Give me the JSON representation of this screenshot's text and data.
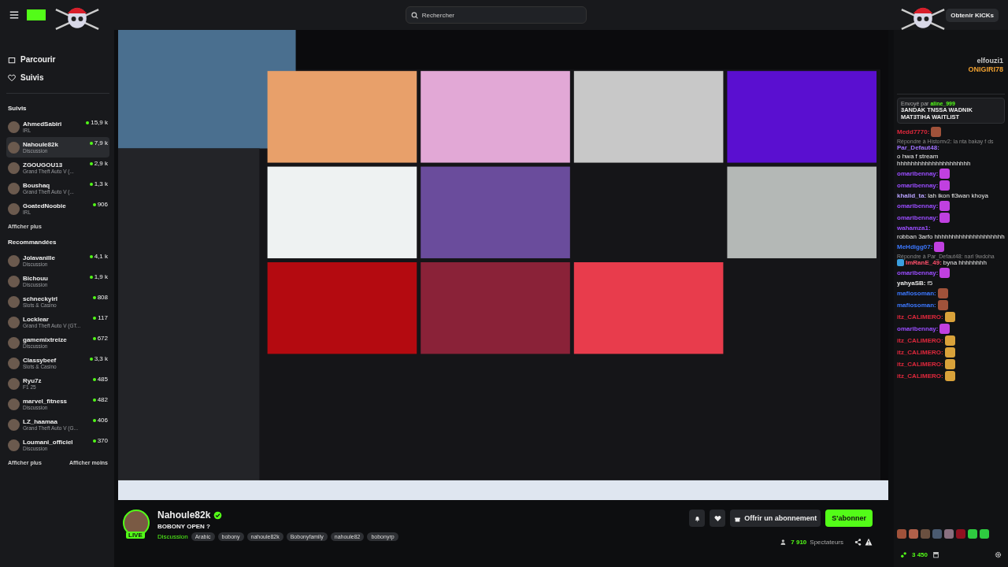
{
  "top_bar": {
    "search": {
      "placeholder": "Rechercher"
    },
    "kicks_button": "Obtenir KICKs"
  },
  "sidebar": {
    "nav": [
      {
        "label": "Parcourir"
      },
      {
        "label": "Suivis"
      }
    ],
    "followed_title": "Suivis",
    "followed": [
      {
        "name": "AhmedSabiri",
        "category": "IRL",
        "viewers": "15,9 k",
        "selected": false
      },
      {
        "name": "Nahoule82k",
        "category": "Discussion",
        "viewers": "7,9 k",
        "selected": true
      },
      {
        "name": "ZGOUGOU13",
        "category": "Grand Theft Auto V (...",
        "viewers": "2,9 k",
        "selected": false
      },
      {
        "name": "Boushaq",
        "category": "Grand Theft Auto V (...",
        "viewers": "1,3 k",
        "selected": false
      },
      {
        "name": "GoatedNoobie",
        "category": "IRL",
        "viewers": "906",
        "selected": false
      }
    ],
    "followed_more": "Afficher plus",
    "recommended_title": "Recommandées",
    "recommended": [
      {
        "name": "Jolavanille",
        "category": "Discussion",
        "viewers": "4,1 k",
        "selected": false
      },
      {
        "name": "Bichouu",
        "category": "Discussion",
        "viewers": "1,9 k",
        "selected": false
      },
      {
        "name": "schneckyirl",
        "category": "Slots & Casino",
        "viewers": "808",
        "selected": false
      },
      {
        "name": "Locklear",
        "category": "Grand Theft Auto V (GT...",
        "viewers": "117",
        "selected": false
      },
      {
        "name": "gamemixtreize",
        "category": "Discussion",
        "viewers": "672",
        "selected": false
      },
      {
        "name": "Classybeef",
        "category": "Slots & Casino",
        "viewers": "3,3 k",
        "selected": false
      },
      {
        "name": "Ryu7z",
        "category": "F1 25",
        "viewers": "485",
        "selected": false
      },
      {
        "name": "marvel_fitness",
        "category": "Discussion",
        "viewers": "482",
        "selected": false
      },
      {
        "name": "LZ_haamaa",
        "category": "Grand Theft Auto V (G...",
        "viewers": "406",
        "selected": false
      },
      {
        "name": "Loumani_officiel",
        "category": "Discussion",
        "viewers": "370",
        "selected": false
      }
    ],
    "more": "Afficher plus",
    "less": "Afficher moins"
  },
  "stream": {
    "streamer": "Nahoule82k",
    "live_badge": "LIVE",
    "title": "BOBONY OPEN ?",
    "category": "Discussion",
    "tags": [
      "Arabic",
      "bobony",
      "nahoule82k",
      "Bobonyfamily",
      "nahoule82",
      "bobonyrp"
    ],
    "gift_button": "Offrir un abonnement",
    "subscribe_button": "S'abonner",
    "viewers": "7 910",
    "viewers_label": "Spectateurs"
  },
  "chat": {
    "leaderboard": [
      {
        "name": "elfouzi1",
        "color": "#c8c8c8"
      },
      {
        "name": "ONIGIRI78",
        "color": "#f0a030"
      }
    ],
    "pinned": {
      "sent_by": "Envoyé par",
      "user": "aline_999",
      "text": "3ANDAK TNSSA WADNIK MAT3TIHA WAITLIST"
    },
    "messages": [
      {
        "user": "Medd7770:",
        "color": "#e0283c",
        "kind": "face"
      },
      {
        "reply": "Répondre à Histomv2: la nta bakay f ds",
        "user": "Par_Defaut48:",
        "color": "#a070ff",
        "kind": "text",
        "text": "o hwa f stream hhhhhhhhhhhhhhhhhhhhh"
      },
      {
        "user": "omaribennay:",
        "color": "#9b4dff",
        "kind": "pepe"
      },
      {
        "user": "omaribennay:",
        "color": "#9b4dff",
        "kind": "pepe"
      },
      {
        "user": "khalid_ta:",
        "color": "#b9a3ff",
        "kind": "text",
        "text": "lah ikon fl3wan khoya"
      },
      {
        "user": "omaribennay:",
        "color": "#9b4dff",
        "kind": "pepe"
      },
      {
        "user": "omaribennay:",
        "color": "#9b4dff",
        "kind": "pepe"
      },
      {
        "user": "wahamza1:",
        "color": "#9b4dff",
        "kind": "text",
        "text": "robban 3arfo hhhhhhhhhhhhhhhhhhhh"
      },
      {
        "user": "MeHdigg07:",
        "color": "#3c78ff",
        "kind": "pepe"
      },
      {
        "reply": "Répondre à Par_Defaut48: narl 9wdoha",
        "user": "ImRanE_49:",
        "color": "#ff4f6a",
        "kind": "text",
        "text": "byna hhhhhhhh",
        "badge": true
      },
      {
        "user": "omaribennay:",
        "color": "#9b4dff",
        "kind": "pepe"
      },
      {
        "user": "yahyaSB:",
        "color": "#e8e8e8",
        "kind": "text",
        "text": "f5"
      },
      {
        "user": "mafiosoman:",
        "color": "#3c78ff",
        "kind": "face"
      },
      {
        "user": "mafiosoman:",
        "color": "#3c78ff",
        "kind": "face"
      },
      {
        "user": "itz_CALIMERO:",
        "color": "#e0283c",
        "kind": "gg"
      },
      {
        "user": "omaribennay:",
        "color": "#9b4dff",
        "kind": "pepe"
      },
      {
        "user": "itz_CALIMERO:",
        "color": "#e0283c",
        "kind": "gg"
      },
      {
        "user": "itz_CALIMERO:",
        "color": "#e0283c",
        "kind": "gg"
      },
      {
        "user": "itz_CALIMERO:",
        "color": "#e0283c",
        "kind": "gg"
      },
      {
        "user": "itz_CALIMERO:",
        "color": "#e0283c",
        "kind": "gg"
      }
    ],
    "points": "3 450"
  }
}
